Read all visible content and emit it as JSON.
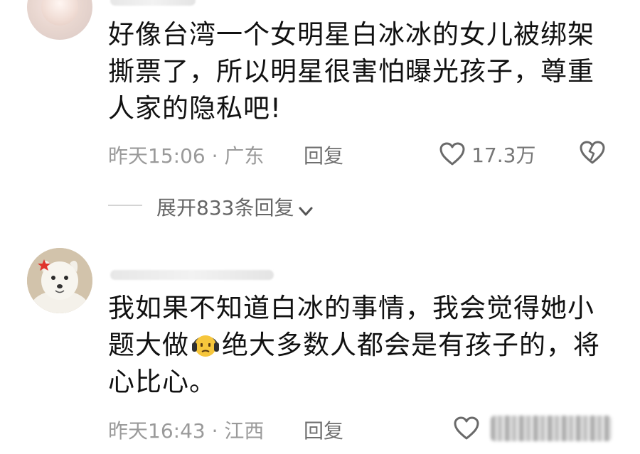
{
  "comment1": {
    "content": "好像台湾一个女明星白冰冰的女儿被绑架撕票了，所以明星很害怕曝光孩子，尊重人家的隐私吧!",
    "time": "昨天15:06",
    "location": "广东",
    "reply_label": "回复",
    "like_count": "17.3万",
    "expand_label": "展开833条回复"
  },
  "comment2": {
    "content_part1": "我如果不知道白冰的事情，我会觉得她小题大做",
    "content_part2": "绝大多数人都会是有孩子的，将心比心。",
    "time": "昨天16:43",
    "location": "江西",
    "reply_label": "回复"
  },
  "icons": {
    "like": "heart-outline-icon",
    "dislike": "broken-heart-icon",
    "expand": "chevron-down-icon",
    "emoji": "headphones-sad-face-emoji"
  },
  "colors": {
    "text": "#111111",
    "meta": "#9a9a9a",
    "reply": "#6f6f6f"
  }
}
